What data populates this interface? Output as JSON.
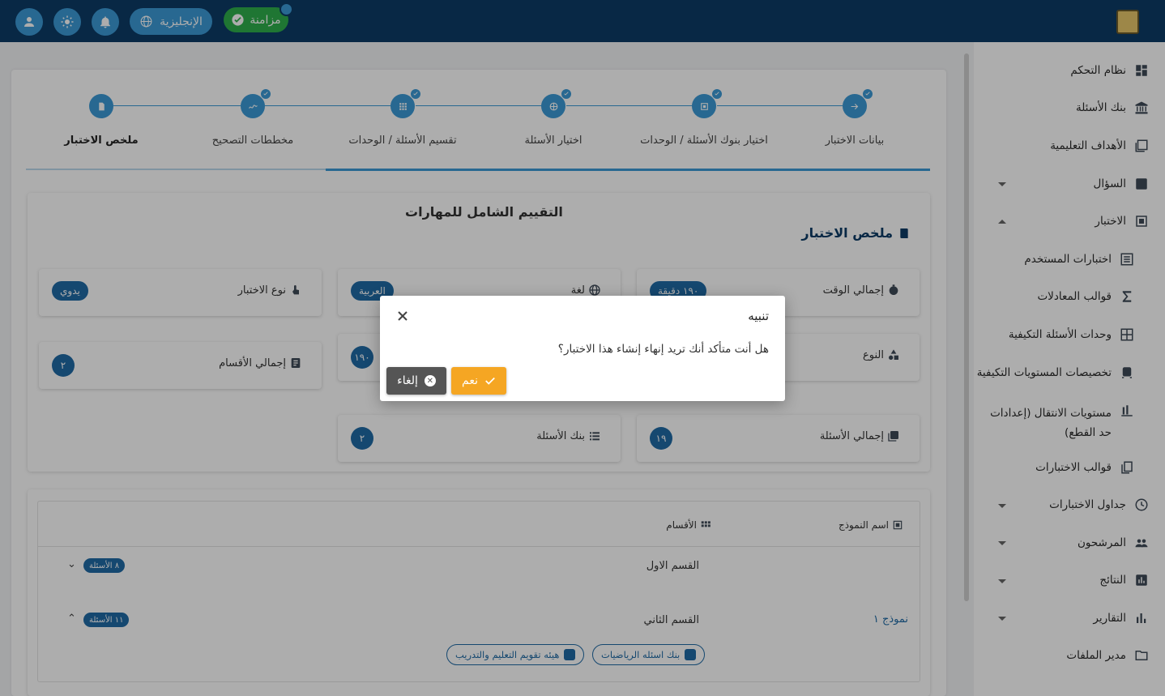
{
  "topbar": {
    "sync_label": "مزامنة",
    "language_label": "الإنجليزية",
    "icons": [
      "user-icon",
      "brightness-icon",
      "bell-icon",
      "globe-icon",
      "check-circle-icon"
    ]
  },
  "sidebar": {
    "items": [
      {
        "label": "نظام التحكم",
        "icon": "dashboard-icon"
      },
      {
        "label": "بنك الأسئلة",
        "icon": "bank-icon"
      },
      {
        "label": "الأهداف التعليمية",
        "icon": "objectives-icon"
      },
      {
        "label": "السؤال",
        "icon": "question-icon",
        "caret": "down"
      },
      {
        "label": "الاختبار",
        "icon": "exam-icon",
        "caret": "up"
      },
      {
        "label": "اختبارات المستخدم",
        "icon": "list-icon"
      },
      {
        "label": "قوالب المعادلات",
        "icon": "sigma-icon"
      },
      {
        "label": "وحدات الأسئلة التكيفية",
        "icon": "grid-icon"
      },
      {
        "label": "تخصيصات المستويات التكيفية",
        "icon": "train-icon"
      },
      {
        "label": "مستويات الانتقال (إعدادات حد القطع)",
        "icon": "bar-icon"
      },
      {
        "label": "قوالب الاختبارات",
        "icon": "copy-icon"
      },
      {
        "label": "جداول الاختبارات",
        "icon": "clock-icon",
        "caret": "down"
      },
      {
        "label": "المرشحون",
        "icon": "people-icon",
        "caret": "down"
      },
      {
        "label": "النتائج",
        "icon": "chart-icon",
        "caret": "down"
      },
      {
        "label": "التقارير",
        "icon": "report-icon",
        "caret": "down"
      },
      {
        "label": "مدير الملفات",
        "icon": "folder-icon"
      }
    ]
  },
  "stepper": {
    "steps": [
      {
        "label": "بيانات الاختبار",
        "done": true
      },
      {
        "label": "اختيار بنوك الأسئلة / الوحدات",
        "done": true
      },
      {
        "label": "اختيار الأسئلة",
        "done": true
      },
      {
        "label": "تقسيم الأسئلة / الوحدات",
        "done": true
      },
      {
        "label": "مخططات التصحيح",
        "done": true
      },
      {
        "label": "ملخص الاختبار",
        "done": false,
        "active": true
      }
    ]
  },
  "summary": {
    "title": "التقييم الشامل للمهارات",
    "heading": "ملخص الاختبار",
    "cards": {
      "total_time": {
        "label": "إجمالي الوقت",
        "value": "١٩٠ دقيقة"
      },
      "language": {
        "label": "لغة",
        "value": "العربية"
      },
      "exam_type": {
        "label": "نوع الاختبار",
        "value": "يدوي"
      },
      "kind": {
        "label": "النوع",
        "value": ""
      },
      "middle_count": {
        "value": "١٩٠"
      },
      "total_sections": {
        "label": "إجمالي الأقسام",
        "value": "٢"
      },
      "total_questions": {
        "label": "إجمالي الأسئلة",
        "value": "١٩"
      },
      "question_banks": {
        "label": "بنك الأسئلة",
        "value": "٢"
      }
    }
  },
  "models_table": {
    "headers": {
      "model_name": "اسم النموذج",
      "sections": "الأقسام"
    },
    "model_name": "نموذج ١",
    "sections": [
      {
        "name": "القسم الاول",
        "questions": "٨ الأسئلة",
        "expanded": false
      },
      {
        "name": "القسم الثاني",
        "questions": "١١ الأسئلة",
        "expanded": true
      }
    ],
    "banks": [
      "بنك اسئله الرياضيات",
      "هيئه تقويم التعليم والتدريب"
    ]
  },
  "dialog": {
    "title": "تنبيه",
    "message": "هل أنت متأكد أنك تريد إنهاء إنشاء هذا الاختبار؟",
    "confirm_label": "نعم",
    "cancel_label": "إلغاء"
  },
  "colors": {
    "navbar": "#0d3b66",
    "accent": "#3b9ad6",
    "confirm": "#f5a623",
    "cancel": "#555555",
    "badge": "#1f6aa5"
  }
}
